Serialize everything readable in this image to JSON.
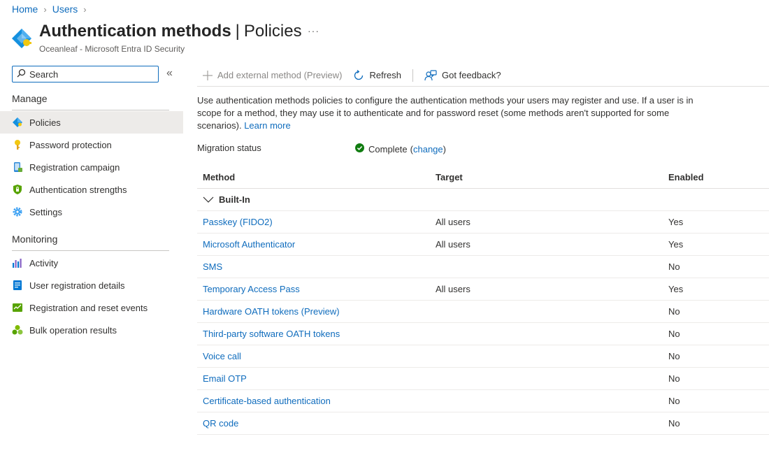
{
  "breadcrumb": {
    "home": "Home",
    "users": "Users",
    "sep": "›"
  },
  "header": {
    "title_main": "Authentication methods",
    "title_pipe": "|",
    "title_sub": "Policies",
    "more": "···",
    "subtitle": "Oceanleaf - Microsoft Entra ID Security"
  },
  "sidebar": {
    "search_placeholder": "Search",
    "collapse": "«",
    "manage_title": "Manage",
    "manage_items": [
      {
        "label": "Policies",
        "icon": "policies-icon"
      },
      {
        "label": "Password protection",
        "icon": "key-icon"
      },
      {
        "label": "Registration campaign",
        "icon": "phone-icon"
      },
      {
        "label": "Authentication strengths",
        "icon": "shield-icon"
      },
      {
        "label": "Settings",
        "icon": "gear-icon"
      }
    ],
    "monitoring_title": "Monitoring",
    "monitoring_items": [
      {
        "label": "Activity",
        "icon": "activity-chart-icon"
      },
      {
        "label": "User registration details",
        "icon": "user-details-icon"
      },
      {
        "label": "Registration and reset events",
        "icon": "events-icon"
      },
      {
        "label": "Bulk operation results",
        "icon": "bulk-results-icon"
      }
    ]
  },
  "toolbar": {
    "add_label": "Add external method (Preview)",
    "refresh_label": "Refresh",
    "feedback_label": "Got feedback?"
  },
  "content": {
    "description": "Use authentication methods policies to configure the authentication methods your users may register and use. If a user is in scope for a method, they may use it to authenticate and for password reset (some methods aren't supported for some scenarios).",
    "learn_more": "Learn more",
    "migration_label": "Migration status",
    "migration_value": "Complete",
    "migration_change": "change"
  },
  "table": {
    "headers": {
      "method": "Method",
      "target": "Target",
      "enabled": "Enabled"
    },
    "group": "Built-In",
    "rows": [
      {
        "method": "Passkey (FIDO2)",
        "target": "All users",
        "enabled": "Yes"
      },
      {
        "method": "Microsoft Authenticator",
        "target": "All users",
        "enabled": "Yes"
      },
      {
        "method": "SMS",
        "target": "",
        "enabled": "No"
      },
      {
        "method": "Temporary Access Pass",
        "target": "All users",
        "enabled": "Yes"
      },
      {
        "method": "Hardware OATH tokens (Preview)",
        "target": "",
        "enabled": "No"
      },
      {
        "method": "Third-party software OATH tokens",
        "target": "",
        "enabled": "No"
      },
      {
        "method": "Voice call",
        "target": "",
        "enabled": "No"
      },
      {
        "method": "Email OTP",
        "target": "",
        "enabled": "No"
      },
      {
        "method": "Certificate-based authentication",
        "target": "",
        "enabled": "No"
      },
      {
        "method": "QR code",
        "target": "",
        "enabled": "No"
      }
    ]
  },
  "colors": {
    "accent": "#0f6cbd",
    "success": "#107c10",
    "selected_bg": "#edebe9"
  }
}
